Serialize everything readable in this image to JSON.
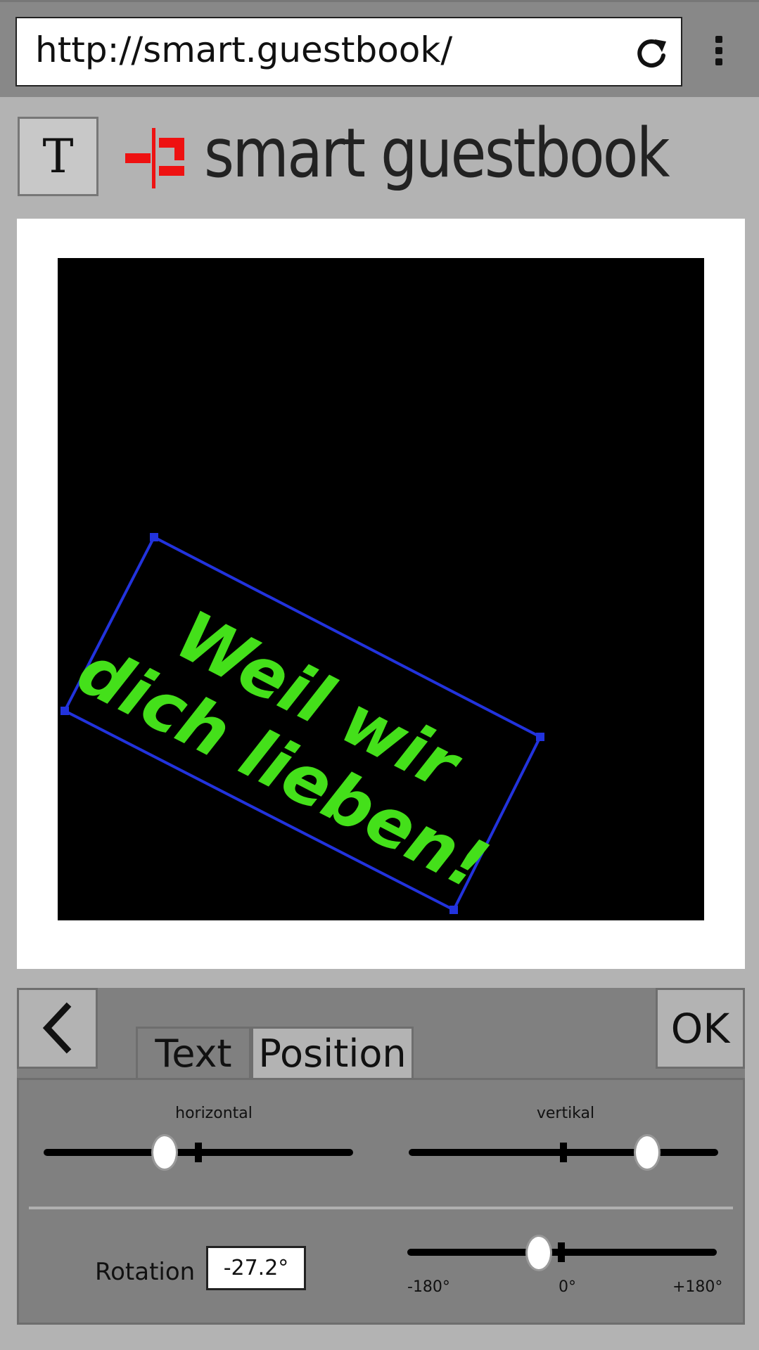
{
  "browser": {
    "url": "http://smart.guestbook/"
  },
  "header": {
    "t_button_label": "T",
    "logo_text": "smart guestbook"
  },
  "canvas": {
    "text_line1": "Weil wir",
    "text_line2": "dich lieben!",
    "text_color": "#44e01a",
    "frame_color": "#2233dd",
    "background_color": "#000000",
    "rotation_deg": -27.2
  },
  "panel": {
    "back_icon": "chevron-left-icon",
    "ok_label": "OK",
    "tabs": [
      {
        "label": "Text",
        "active": false
      },
      {
        "label": "Position",
        "active": true
      }
    ],
    "horizontal": {
      "label": "horizontal",
      "value_fraction": 0.39
    },
    "vertikal": {
      "label": "vertikal",
      "value_fraction": 0.77
    },
    "rotation": {
      "label": "Rotation",
      "value": "-27.2°",
      "min_label": "-180°",
      "mid_label": "0°",
      "max_label": "+180°",
      "value_deg": -27.2
    }
  }
}
